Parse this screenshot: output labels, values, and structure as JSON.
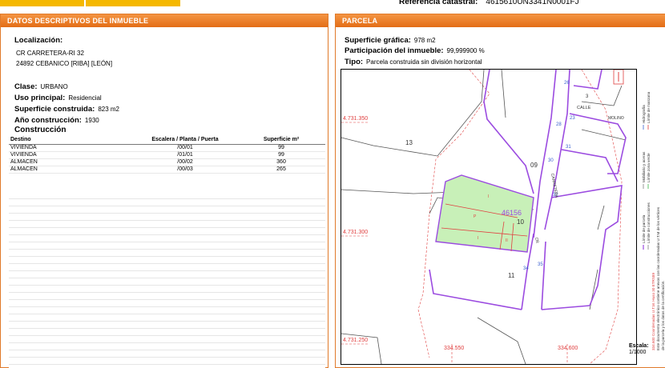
{
  "header": {
    "ref_label": "Referencia catastral:",
    "ref_value": "4615610UN3341N0001FJ"
  },
  "left_panel": {
    "title": "DATOS DESCRIPTIVOS DEL INMUEBLE",
    "localizacion_label": "Localización:",
    "address_line1": "CR CARRETERA-RI 32",
    "address_line2": "24892 CEBANICO [RIBA] [LEÓN]",
    "clase_label": "Clase:",
    "clase_value": "URBANO",
    "uso_label": "Uso principal:",
    "uso_value": "Residencial",
    "sup_label": "Superficie construida:",
    "sup_value": "823 m2",
    "anio_label": "Año construcción:",
    "anio_value": "1930",
    "construccion_title": "Construcción",
    "table_headers": [
      "Destino",
      "Escalera / Planta / Puerta",
      "Superficie m²"
    ],
    "table_rows": [
      [
        "VIVIENDA",
        "/00/01",
        "99"
      ],
      [
        "VIVIENDA",
        "/01/01",
        "99"
      ],
      [
        "ALMACEN",
        "/00/02",
        "360"
      ],
      [
        "ALMACEN",
        "/00/03",
        "265"
      ]
    ]
  },
  "right_panel": {
    "title": "PARCELA",
    "sup_grafica_label": "Superficie gráfica:",
    "sup_grafica_value": "978 m2",
    "participacion_label": "Participación del inmueble:",
    "participacion_value": "99,999900 %",
    "tipo_label": "Tipo:",
    "tipo_value": "Parcela construida sin división horizontal"
  },
  "map": {
    "coord_labels": [
      "4.731.350",
      "4.731.300",
      "4.731.250",
      "334.550",
      "334.600"
    ],
    "parcel_numbers": [
      "13",
      "09",
      "10",
      "11"
    ],
    "street_numbers": [
      "26",
      "3",
      "28",
      "23",
      "30",
      "31",
      "32",
      "34",
      "35"
    ],
    "street_names": [
      "CALLE",
      "MOLINO",
      "CARRETERA",
      "CR"
    ],
    "plot_ref": "46156",
    "building_codes": [
      "I",
      "P",
      "I",
      "II"
    ],
    "legend_lines": [
      "Límite de parcela",
      "Límite de construcciones",
      "Mobiliario y aceras",
      "Límite zona verde",
      "Hidrografía",
      "Límite de manzana"
    ],
    "note_line1": "334.600 Coordenadas U.T.M. Huso 30 ETRS89",
    "note_line2": "Este documento electrónico contiene anexos con las coordenadas U.T.M de los vértices",
    "note_line3": "de la parcela y los datos de la certificación.",
    "scale_label": "Escala:",
    "scale_value": "1/1000"
  },
  "colors": {
    "accent": "#e36d16",
    "yellow": "#f5b800",
    "parcel_outline": "#9b4be0",
    "green_fill": "#c8f0b8",
    "coord_red": "#e04040"
  }
}
